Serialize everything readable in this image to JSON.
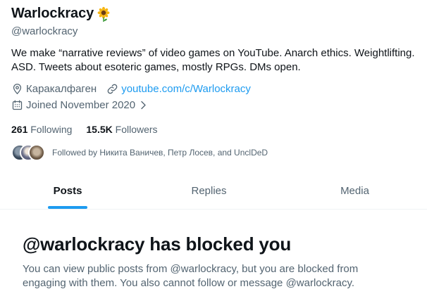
{
  "profile": {
    "display_name": "Warlockracy",
    "emoji": "sunflower-emoji",
    "handle": "@warlockracy",
    "bio": "We make “narrative reviews” of video games on YouTube. Anarch ethics. Weightlifting. ASD. Tweets about esoteric games, mostly RPGs. DMs open.",
    "location": "Каракалфаген",
    "website": "youtube.com/c/Warlockracy",
    "joined": "Joined November 2020"
  },
  "stats": {
    "following_count": "261",
    "following_label": "Following",
    "followers_count": "15.5K",
    "followers_label": "Followers"
  },
  "followed_by": {
    "text": "Followed by Никита Ваничев, Петр Лосев, and UnclDeD"
  },
  "tabs": [
    {
      "label": "Posts",
      "active": true
    },
    {
      "label": "Replies",
      "active": false
    },
    {
      "label": "Media",
      "active": false
    }
  ],
  "blocked": {
    "title": "@warlockracy has blocked you",
    "description": "You can view public posts from @warlockracy, but you are blocked from engaging with them. You also cannot follow or message @warlockracy."
  },
  "colors": {
    "accent": "#1d9bf0",
    "text_primary": "#0f1419",
    "text_secondary": "#536471"
  },
  "icons": [
    "location-pin-icon",
    "link-icon",
    "calendar-icon",
    "chevron-right-icon"
  ]
}
